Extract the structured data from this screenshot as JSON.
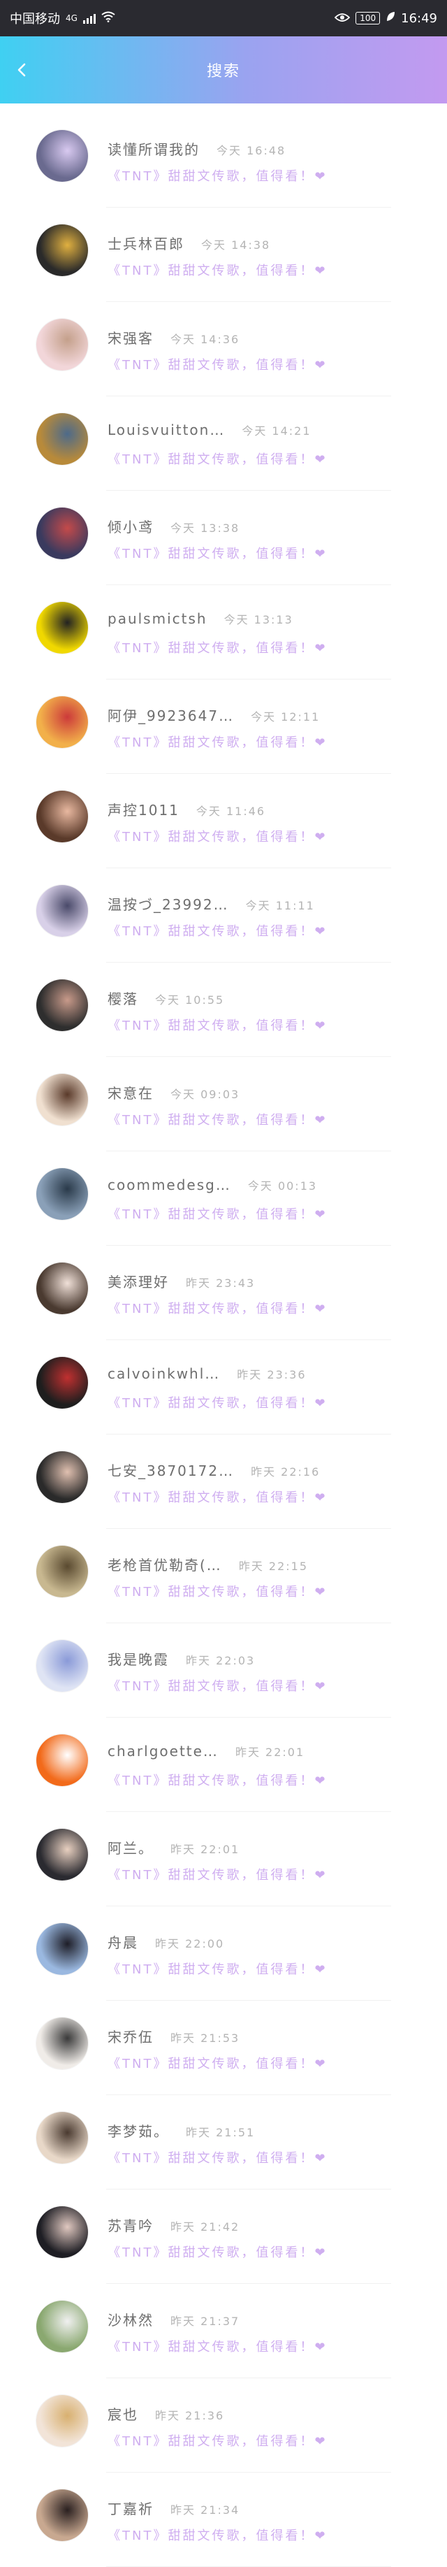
{
  "status_bar": {
    "carrier": "中国移动",
    "network": "4G",
    "battery": "100",
    "time": "16:49"
  },
  "header": {
    "title": "搜索"
  },
  "colors": {
    "header_from": "#3fd0f2",
    "header_to": "#c39af0",
    "message": "#cfaef0"
  },
  "results": [
    {
      "name": "读懂所谓我的",
      "time": "今天 16:48",
      "message": "《TNT》甜甜文传歌，值得看！❤",
      "avatar_color": "#6a6a8f",
      "avatar_accent": "#d8c9f0"
    },
    {
      "name": "士兵林百郎",
      "time": "今天 14:38",
      "message": "《TNT》甜甜文传歌，值得看！❤",
      "avatar_color": "#2a2a2a",
      "avatar_accent": "#e0b040"
    },
    {
      "name": "宋强客",
      "time": "今天 14:36",
      "message": "《TNT》甜甜文传歌，值得看！❤",
      "avatar_color": "#f2d6d9",
      "avatar_accent": "#c4a08b"
    },
    {
      "name": "Louisvuitton…",
      "time": "今天 14:21",
      "message": "《TNT》甜甜文传歌，值得看！❤",
      "avatar_color": "#b88a3a",
      "avatar_accent": "#4d6a8a"
    },
    {
      "name": "倾小鸢",
      "time": "今天 13:38",
      "message": "《TNT》甜甜文传歌，值得看！❤",
      "avatar_color": "#3a3a5e",
      "avatar_accent": "#c44a4a"
    },
    {
      "name": "paulsmictsh",
      "time": "今天 13:13",
      "message": "《TNT》甜甜文传歌，值得看！❤",
      "avatar_color": "#f0d800",
      "avatar_accent": "#222222"
    },
    {
      "name": "阿伊_9923647…",
      "time": "今天 12:11",
      "message": "《TNT》甜甜文传歌，值得看！❤",
      "avatar_color": "#f2b04a",
      "avatar_accent": "#cc3a3a"
    },
    {
      "name": "声控1011",
      "time": "今天 11:46",
      "message": "《TNT》甜甜文传歌，值得看！❤",
      "avatar_color": "#5a3a2a",
      "avatar_accent": "#e8b8a0"
    },
    {
      "name": "温按づ_23992…",
      "time": "今天 11:11",
      "message": "《TNT》甜甜文传歌，值得看！❤",
      "avatar_color": "#d8d0e8",
      "avatar_accent": "#4a4a6a"
    },
    {
      "name": "樱落",
      "time": "今天 10:55",
      "message": "《TNT》甜甜文传歌，值得看！❤",
      "avatar_color": "#2e2e2e",
      "avatar_accent": "#c89a8a"
    },
    {
      "name": "宋意在",
      "time": "今天 09:03",
      "message": "《TNT》甜甜文传歌，值得看！❤",
      "avatar_color": "#f0e0d0",
      "avatar_accent": "#5a3a2a"
    },
    {
      "name": "coommedesg…",
      "time": "今天 00:13",
      "message": "《TNT》甜甜文传歌，值得看！❤",
      "avatar_color": "#8aa0b8",
      "avatar_accent": "#2a3a4a"
    },
    {
      "name": "美添理好",
      "time": "昨天 23:43",
      "message": "《TNT》甜甜文传歌，值得看！❤",
      "avatar_color": "#4a3a30",
      "avatar_accent": "#f0e0d8"
    },
    {
      "name": "calvoinkwhl…",
      "time": "昨天 23:36",
      "message": "《TNT》甜甜文传歌，值得看！❤",
      "avatar_color": "#1e1e1e",
      "avatar_accent": "#c03030"
    },
    {
      "name": "七安_3870172…",
      "time": "昨天 22:16",
      "message": "《TNT》甜甜文传歌，值得看！❤",
      "avatar_color": "#2a2a2a",
      "avatar_accent": "#e0c0b0"
    },
    {
      "name": "老枪首优勒奇(…",
      "time": "昨天 22:15",
      "message": "《TNT》甜甜文传歌，值得看！❤",
      "avatar_color": "#c8b890",
      "avatar_accent": "#5a4a30"
    },
    {
      "name": "我是晚霞",
      "time": "昨天 22:03",
      "message": "《TNT》甜甜文传歌，值得看！❤",
      "avatar_color": "#dfe4f4",
      "avatar_accent": "#8a9ad8"
    },
    {
      "name": "charlgoette…",
      "time": "昨天 22:01",
      "message": "《TNT》甜甜文传歌，值得看！❤",
      "avatar_color": "#f26a1a",
      "avatar_accent": "#ffffff"
    },
    {
      "name": "阿兰。",
      "time": "昨天 22:01",
      "message": "《TNT》甜甜文传歌，值得看！❤",
      "avatar_color": "#2a2a30",
      "avatar_accent": "#e8d0c0"
    },
    {
      "name": "舟晨",
      "time": "昨天 22:00",
      "message": "《TNT》甜甜文传歌，值得看！❤",
      "avatar_color": "#9ab8e0",
      "avatar_accent": "#1e1e28"
    },
    {
      "name": "宋乔伍",
      "time": "昨天 21:53",
      "message": "《TNT》甜甜文传歌，值得看！❤",
      "avatar_color": "#f0ece8",
      "avatar_accent": "#3a3a3a"
    },
    {
      "name": "李梦茹。",
      "time": "昨天 21:51",
      "message": "《TNT》甜甜文传歌，值得看！❤",
      "avatar_color": "#e8d8c8",
      "avatar_accent": "#4a3a30"
    },
    {
      "name": "苏青吟",
      "time": "昨天 21:42",
      "message": "《TNT》甜甜文传歌，值得看！❤",
      "avatar_color": "#1e1e24",
      "avatar_accent": "#e0c8c0"
    },
    {
      "name": "沙林然",
      "time": "昨天 21:37",
      "message": "《TNT》甜甜文传歌，值得看！❤",
      "avatar_color": "#8aa870",
      "avatar_accent": "#f0f0f0"
    },
    {
      "name": "宸也",
      "time": "昨天 21:36",
      "message": "《TNT》甜甜文传歌，值得看！❤",
      "avatar_color": "#f2e4d8",
      "avatar_accent": "#d8b070"
    },
    {
      "name": "丁嘉祈",
      "time": "昨天 21:34",
      "message": "《TNT》甜甜文传歌，值得看！❤",
      "avatar_color": "#c8a890",
      "avatar_accent": "#2a2020"
    }
  ]
}
